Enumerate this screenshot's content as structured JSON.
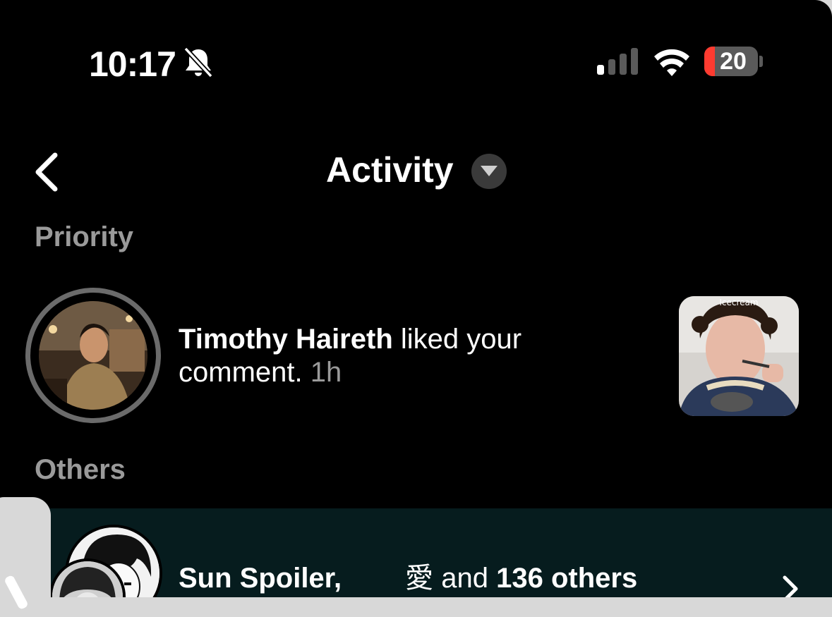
{
  "status_bar": {
    "time": "10:17",
    "battery_level": "20",
    "battery_fraction": 0.2,
    "signal_bars": 1,
    "icons": [
      "bell-slash-icon",
      "signal-icon",
      "wifi-icon",
      "battery-icon"
    ]
  },
  "header": {
    "title": "Activity",
    "back_icon": "chevron-left-icon",
    "dropdown_icon": "caret-down-icon"
  },
  "sections": {
    "priority": "Priority",
    "others": "Others"
  },
  "priority_item": {
    "user": "Timothy Haireth",
    "action": " liked your comment.",
    "time": " 1h",
    "thumbnail_caption": "Icecream"
  },
  "others_item": {
    "users": "Sun Spoiler,",
    "second_user": "愛",
    "joiner": " and ",
    "count": "136 others"
  },
  "colors": {
    "background": "#000000",
    "section_text": "#9a9a9a",
    "battery_low": "#ff3b30",
    "highlight_row": "#061c1e"
  }
}
